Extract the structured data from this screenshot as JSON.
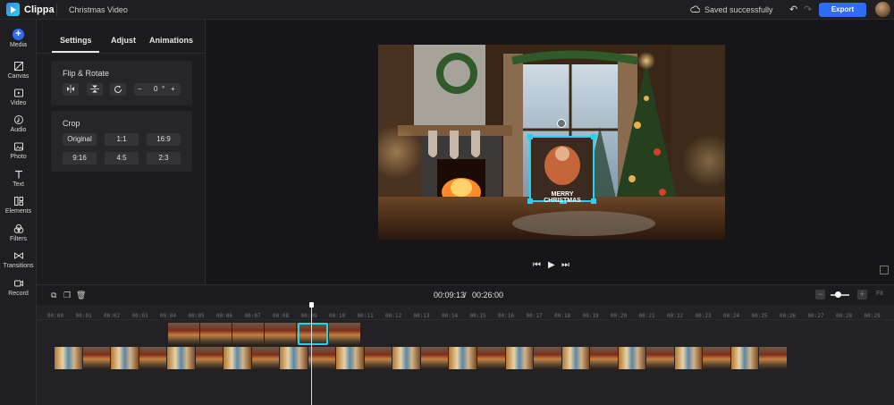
{
  "app": {
    "name": "Clippa",
    "project_title": "Christmas Video",
    "status": "Saved successfully",
    "export_label": "Export"
  },
  "rail": [
    {
      "label": "Media",
      "icon": "plus-icon"
    },
    {
      "label": "Canvas",
      "icon": "canvas-icon"
    },
    {
      "label": "Video",
      "icon": "video-icon"
    },
    {
      "label": "Audio",
      "icon": "audio-icon"
    },
    {
      "label": "Photo",
      "icon": "photo-icon"
    },
    {
      "label": "Text",
      "icon": "text-icon"
    },
    {
      "label": "Elements",
      "icon": "elements-icon"
    },
    {
      "label": "Filters",
      "icon": "filters-icon"
    },
    {
      "label": "Transitions",
      "icon": "transitions-icon"
    },
    {
      "label": "Record",
      "icon": "record-icon"
    }
  ],
  "panel": {
    "tabs": [
      "Settings",
      "Adjust",
      "Animations"
    ],
    "flip_rotate": {
      "title": "Flip & Rotate",
      "rotation_value": "0",
      "rotation_unit": "°"
    },
    "crop": {
      "title": "Crop",
      "options": [
        "Original",
        "1:1",
        "16:9",
        "9:16",
        "4:5",
        "2:3"
      ]
    }
  },
  "preview": {
    "overlay_text": "MERRY CHRISTMAS"
  },
  "timeline": {
    "current_time": "00:09:13",
    "separator": "/",
    "total_time": "00:26:00",
    "fit_label": "Fit",
    "ruler": [
      "00:00",
      "00:01",
      "00:02",
      "00:03",
      "00:04",
      "00:05",
      "00:06",
      "00:07",
      "00:08",
      "00:09",
      "00:10",
      "00:11",
      "00:12",
      "00:13",
      "00:14",
      "00:15",
      "00:16",
      "00:17",
      "00:18",
      "00:19",
      "00:20",
      "00:21",
      "00:22",
      "00:23",
      "00:24",
      "00:25",
      "00:26",
      "00:27",
      "00:28",
      "00:29"
    ]
  },
  "colors": {
    "accent": "#2f6df6",
    "selection": "#22d3ee"
  }
}
